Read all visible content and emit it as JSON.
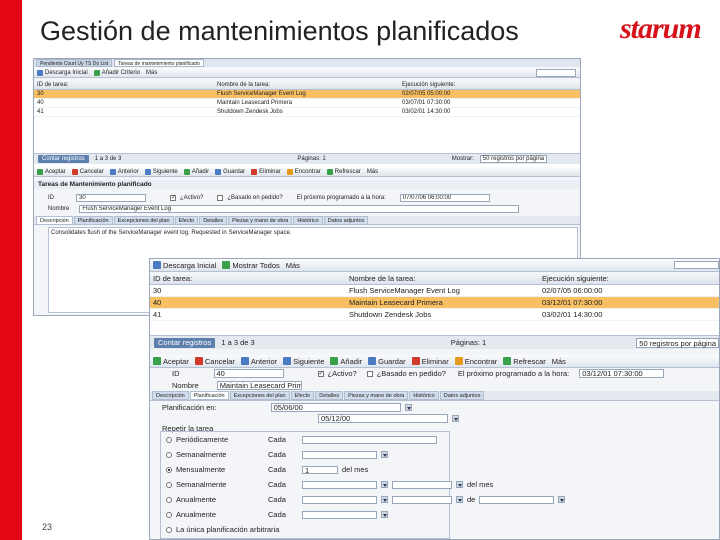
{
  "slide": {
    "title": "Gestión de mantenimientos planificados",
    "logo": "starum",
    "page_number": "23"
  },
  "shot1": {
    "tabs": [
      "Pendiente Court Uy TS Do List",
      "Tareas de mantenimiento planificado"
    ],
    "toolbar": [
      "Descarga Inicial",
      "Añadir Criterio",
      "Más"
    ],
    "columns": [
      "ID de tarea:",
      "Nombre de la tarea:",
      "Ejecución siguiente:"
    ],
    "rows": [
      [
        "30",
        "Flush ServiceManager Event Log",
        "02/07/05 05:00:00"
      ],
      [
        "40",
        "Maintain Leasecard Primera",
        "03/07/01 07:30:00"
      ],
      [
        "41",
        "Shutdown Zendesk Jobs",
        "03/02/01 14:30:00"
      ]
    ],
    "pager": {
      "button": "Contar registros",
      "count": "1 a 3 de 3",
      "pages": "Páginas: 1",
      "show_label": "Mostrar:",
      "per_page": "50 registros por página"
    },
    "toolbar2": [
      "Aceptar",
      "Cancelar",
      "Anterior",
      "Siguiente",
      "Añadir",
      "Guardar",
      "Eliminar",
      "Encontrar",
      "Refrescar",
      "Más"
    ],
    "form_title": "Tareas de Mantenimiento planificado",
    "id_label": "ID",
    "id_value": "30",
    "active_label": "¿Activo?",
    "based_label": "¿Basado en pedido?",
    "next_label": "El próximo programado a la hora:",
    "next_value": "07/07/06 06:00:00",
    "name_label": "Nombre",
    "name_value": "Flush ServiceManager Event Log",
    "subtabs": [
      "Descripción",
      "Planificación",
      "Excepciones del plan",
      "Efecto",
      "Detalles",
      "Piezas y mano de obra",
      "Histórico",
      "Datos adjuntos"
    ],
    "description": "Consolidates flush of the ServiceManager event log. Requested in ServiceManager space."
  },
  "shot2": {
    "toolbar": [
      "Descarga Inicial",
      "Mostrar Todos",
      "Más"
    ],
    "columns": [
      "ID de tarea:",
      "Nombre de la tarea:",
      "Ejecución siguiente:"
    ],
    "rows": [
      [
        "30",
        "Flush ServiceManager Event Log",
        "02/07/05 06:00:00"
      ],
      [
        "40",
        "Maintain Leasecard Primera",
        "03/12/01 07:30:00"
      ],
      [
        "41",
        "Shutdown Zendesk Jobs",
        "03/02/01 14:30:00"
      ]
    ],
    "pager": {
      "button": "Contar registros",
      "count": "1 a 3 de 3",
      "pages": "Páginas: 1",
      "per_page": "50 registros por página"
    },
    "toolbar2": [
      "Aceptar",
      "Cancelar",
      "Anterior",
      "Siguiente",
      "Añadir",
      "Guardar",
      "Eliminar",
      "Encontrar",
      "Refrescar",
      "Más"
    ],
    "id_label": "ID",
    "id_value": "40",
    "active_label": "¿Activo?",
    "based_label": "¿Basado en pedido?",
    "next_label": "El próximo programado a la hora:",
    "next_value": "03/12/01 07:30:00",
    "name_label": "Nombre",
    "name_value": "Maintain Leasecard Primera",
    "subtabs": [
      "Descripción",
      "Planificación",
      "Excepciones del plan",
      "Efecto",
      "Detalles",
      "Piezas y mano de obra",
      "Histórico",
      "Datos adjuntos"
    ],
    "plan_start_label": "Planificación en:",
    "plan_start": "05/06/00",
    "plan_end": "05/12/00",
    "frequency_label": "Repetir la tarea",
    "options": [
      {
        "label": "Periódicamente",
        "unit": "Cada",
        "selected": false
      },
      {
        "label": "Semanalmente",
        "unit": "Cada",
        "selected": false
      },
      {
        "label": "Mensualmente",
        "unit": "Cada",
        "selected": true,
        "value": "1",
        "suffix": "del mes"
      },
      {
        "label": "Semanalmente",
        "unit": "Cada",
        "selected": false,
        "suffix": "del mes"
      },
      {
        "label": "Anualmente",
        "unit": "Cada",
        "selected": false,
        "suffix": "de"
      },
      {
        "label": "Anualmente",
        "unit": "Cada",
        "selected": false
      },
      {
        "label": "La única planificación arbitraria",
        "unit": "",
        "selected": false
      }
    ]
  }
}
